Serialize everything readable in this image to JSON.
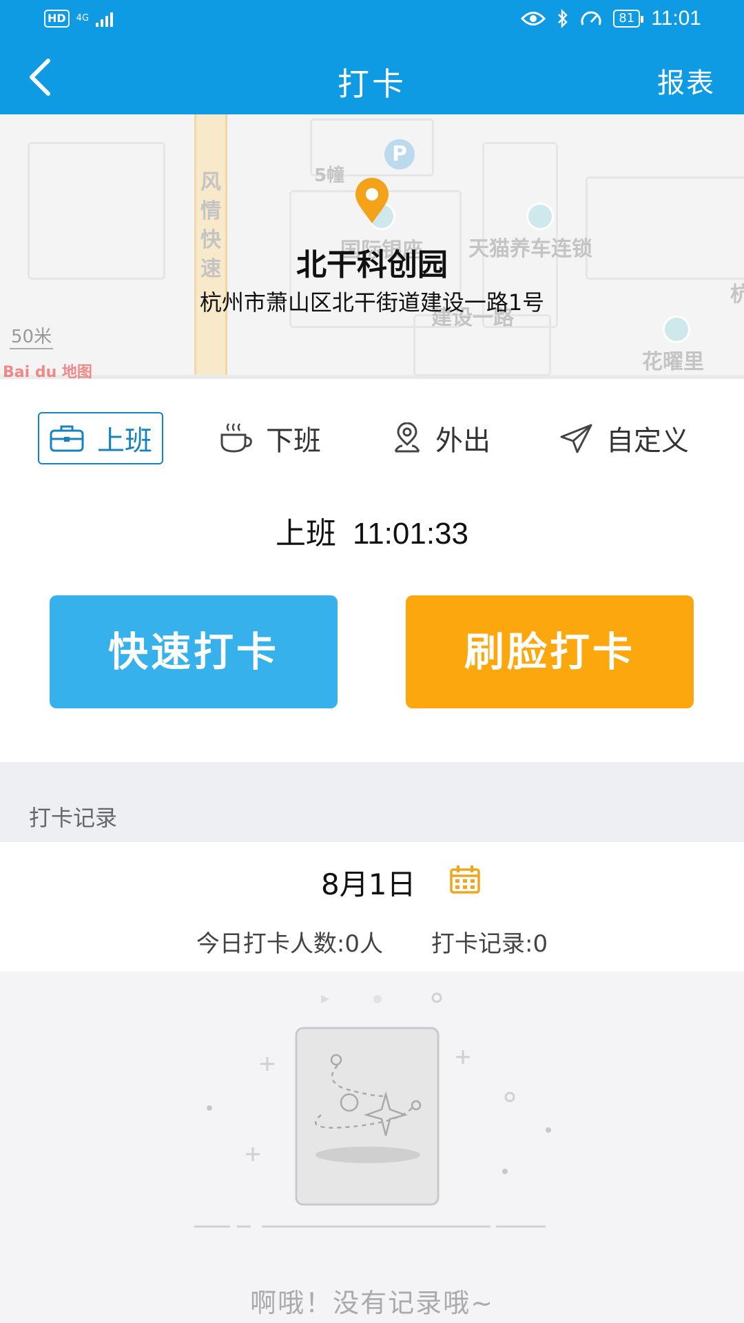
{
  "status_bar": {
    "hd": "HD",
    "network": "4G",
    "battery": "81",
    "time": "11:01"
  },
  "header": {
    "title": "打卡",
    "report_label": "报表"
  },
  "map": {
    "place_name": "北干科创园",
    "address": "杭州市萧山区北干街道建设一路1号",
    "labels": {
      "road": "风情快速",
      "building": "5幢",
      "poi1": "国际银座",
      "poi2": "天猫养车连锁",
      "street": "建设一路",
      "poi3": "花曜里",
      "edge": "杭"
    },
    "scale": "50米",
    "provider": "Bai du 地图"
  },
  "punch_types": [
    {
      "label": "上班",
      "icon": "briefcase-icon",
      "active": true
    },
    {
      "label": "下班",
      "icon": "coffee-cup-icon",
      "active": false
    },
    {
      "label": "外出",
      "icon": "location-person-icon",
      "active": false
    },
    {
      "label": "自定义",
      "icon": "send-icon",
      "active": false
    }
  ],
  "current": {
    "type": "上班",
    "time": "11:01:33"
  },
  "buttons": {
    "quick": "快速打卡",
    "face": "刷脸打卡"
  },
  "records": {
    "section_title": "打卡记录",
    "date": "8月1日",
    "people_count": "今日打卡人数:0人",
    "record_count": "打卡记录:0",
    "empty_text": "啊哦！没有记录哦~"
  },
  "colors": {
    "primary": "#0f9ae4",
    "quick_button": "#36b1ec",
    "face_button": "#fba70d",
    "active_type": "#1583bd",
    "calendar_icon": "#f1a51b",
    "pin": "#f5a21b"
  }
}
